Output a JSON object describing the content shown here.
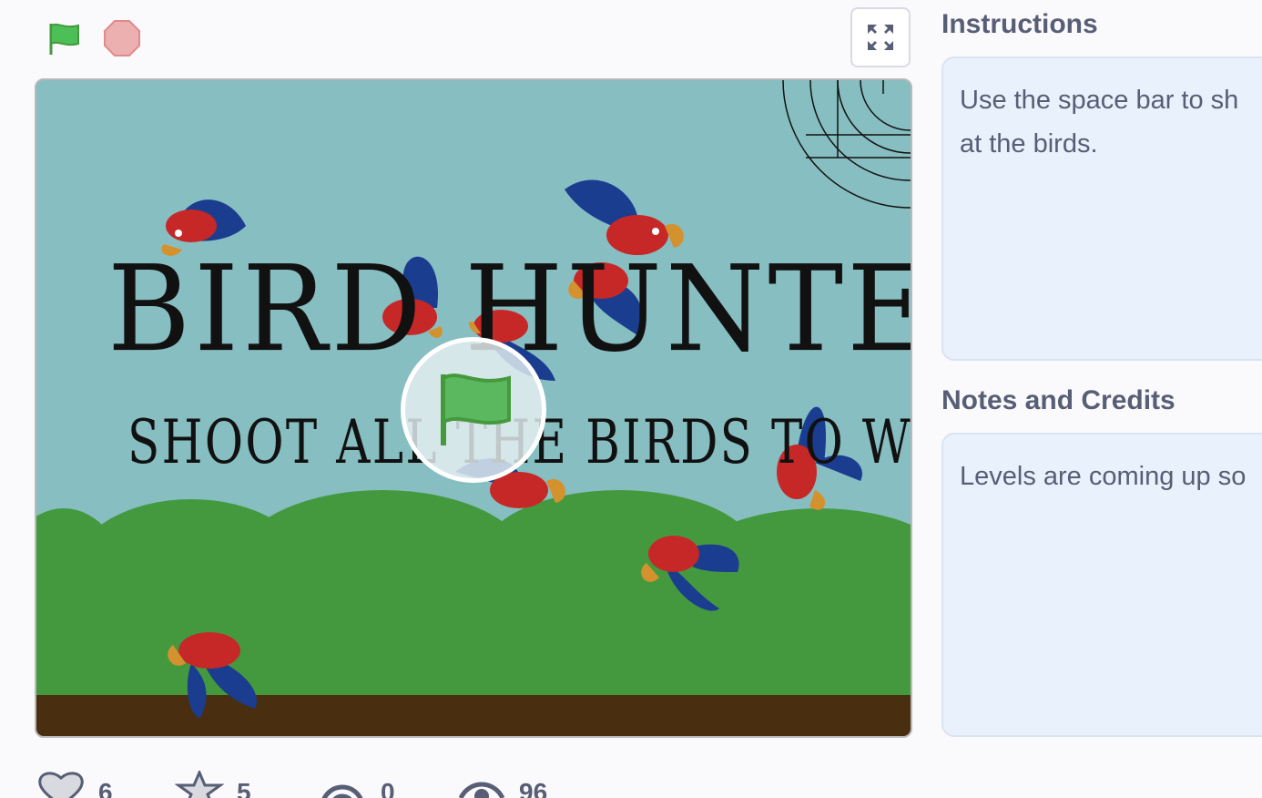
{
  "controls": {
    "green_flag_icon": "green-flag-icon",
    "stop_icon": "stop-icon",
    "fullscreen_icon": "fullscreen-icon"
  },
  "stage": {
    "title": "BIRD HUNTER",
    "subtitle": "SHOOT ALL THE BIRDS TO WIN",
    "start_icon": "green-flag-icon",
    "colors": {
      "sky": "#87bec1",
      "hills": "#44993f",
      "ground": "#4a2e10",
      "bird_red": "#c62828",
      "bird_blue": "#1a3d8f"
    }
  },
  "instructions": {
    "title": "Instructions",
    "text_line1": "Use the space bar to sh",
    "text_line2": "at the birds."
  },
  "notes": {
    "title": "Notes and Credits",
    "text": "Levels are coming up so"
  },
  "stats": {
    "loves": "6",
    "favorites": "5",
    "remixes": "0",
    "views": "96"
  }
}
